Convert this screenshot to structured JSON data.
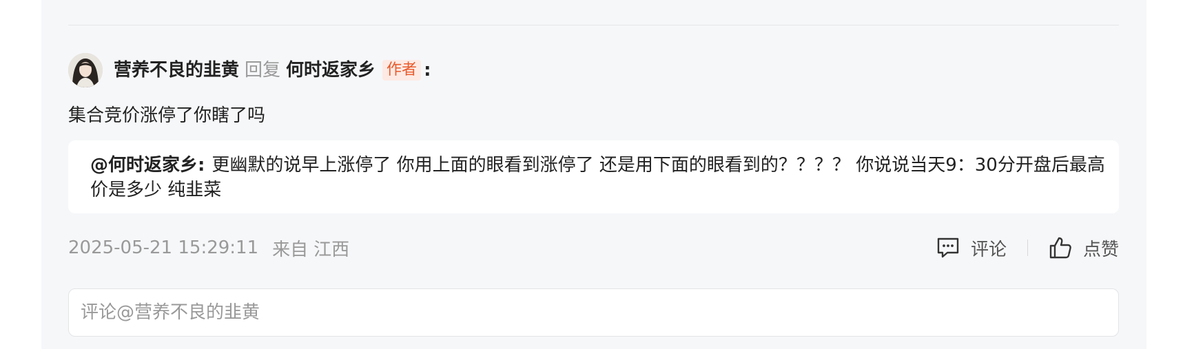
{
  "reply": {
    "author": "营养不良的韭黄",
    "reply_word": "回复",
    "target": "何时返家乡",
    "target_badge": "作者",
    "colon": ":",
    "text": "集合竞价涨停了你瞎了吗"
  },
  "quote": {
    "mention": "@何时返家乡:",
    "body": "更幽默的说早上涨停了 你用上面的眼看到涨停了 还是用下面的眼看到的？？？？ 你说说当天9：30分开盘后最高价是多少 纯韭菜"
  },
  "meta": {
    "timestamp": "2025-05-21 15:29:11",
    "location_label": "来自",
    "location": "江西"
  },
  "actions": {
    "comment_icon": "comment-bubble-icon",
    "comment_label": "评论",
    "like_icon": "thumbs-up-icon",
    "like_label": "点赞"
  },
  "input": {
    "placeholder": "评论@营养不良的韭黄"
  },
  "colors": {
    "badge_text": "#e85a2c",
    "badge_bg": "#fdeae4",
    "panel_bg": "#f6f7f9",
    "muted_text": "#999999"
  }
}
